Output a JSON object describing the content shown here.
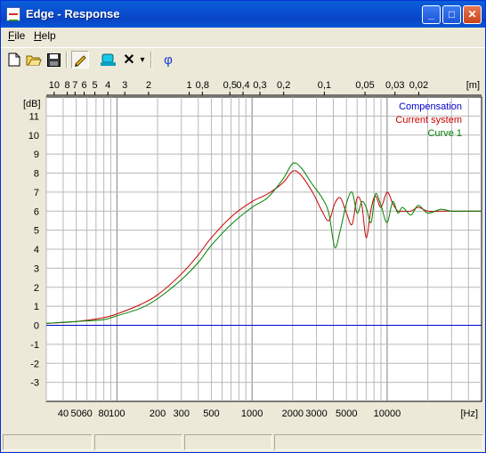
{
  "window": {
    "title": "Edge - Response",
    "minimize_glyph": "_",
    "maximize_glyph": "□",
    "close_glyph": "✕"
  },
  "menu": [
    "File",
    "Help"
  ],
  "toolbar": {
    "icons": [
      "new-file-icon",
      "open-folder-icon",
      "save-disk-icon",
      "pencil-icon",
      "cursor-icon",
      "delete-x-icon",
      "dropdown-arrow-icon",
      "phase-icon"
    ],
    "phase_label": "φ",
    "delete_label": "✕",
    "dropdown_label": "▾"
  },
  "chart_data": {
    "type": "line",
    "xscale": "log",
    "xlim": [
      30,
      50000
    ],
    "ylim": [
      -4,
      12
    ],
    "ylabel": "[dB]",
    "xlabel": "[Hz]",
    "top_axis_label": "[m]",
    "x_ticks": [
      "40",
      "50",
      "60",
      "80",
      "100",
      "200",
      "300",
      "500",
      "1000",
      "2000",
      "3000",
      "5000",
      "10000"
    ],
    "y_ticks": [
      "11",
      "10",
      "9",
      "8",
      "7",
      "6",
      "5",
      "4",
      "3",
      "2",
      "1",
      "0",
      "-1",
      "-2",
      "-3"
    ],
    "top_ticks": [
      "10",
      "8",
      "7",
      "6",
      "5",
      "4",
      "3",
      "2",
      "1",
      "0,8",
      "0,5",
      "0,4",
      "0,3",
      "0,2",
      "0,1",
      "0,05",
      "0,03",
      "0,02"
    ],
    "grid": true,
    "legend_position": "top-right",
    "series": [
      {
        "name": "Compensation",
        "color": "#0000cc",
        "x": [
          30,
          50000
        ],
        "y": [
          0,
          0
        ]
      },
      {
        "name": "Current system",
        "color": "#cc0000",
        "x": [
          30,
          50,
          80,
          100,
          150,
          200,
          300,
          400,
          500,
          700,
          1000,
          1300,
          1700,
          2000,
          2300,
          2800,
          3300,
          3700,
          4100,
          4500,
          5000,
          5500,
          6000,
          6500,
          7000,
          7600,
          8200,
          9000,
          10000,
          11000,
          12000,
          13000,
          15000,
          17000,
          20000,
          25000,
          30000,
          40000,
          50000
        ],
        "y": [
          0.1,
          0.2,
          0.4,
          0.6,
          1.1,
          1.6,
          2.7,
          3.7,
          4.6,
          5.7,
          6.5,
          6.9,
          7.5,
          8.1,
          7.9,
          7.0,
          6.0,
          5.5,
          6.4,
          6.7,
          5.9,
          5.3,
          6.7,
          6.3,
          4.6,
          6.1,
          6.8,
          6.2,
          7.0,
          6.4,
          6.0,
          6.0,
          6.0,
          6.2,
          6.0,
          6.0,
          6.0,
          6.0,
          6.0
        ]
      },
      {
        "name": "Curve 1",
        "color": "#008000",
        "x": [
          30,
          50,
          80,
          100,
          150,
          200,
          300,
          400,
          500,
          700,
          1000,
          1300,
          1700,
          2000,
          2300,
          2800,
          3300,
          3700,
          4100,
          4500,
          5000,
          5500,
          6000,
          6500,
          7000,
          7600,
          8200,
          9000,
          10000,
          11000,
          12000,
          13000,
          15000,
          17000,
          20000,
          25000,
          30000,
          40000,
          50000
        ],
        "y": [
          0.1,
          0.2,
          0.3,
          0.5,
          0.9,
          1.4,
          2.4,
          3.3,
          4.2,
          5.3,
          6.2,
          6.7,
          7.7,
          8.5,
          8.3,
          7.4,
          6.7,
          5.9,
          4.1,
          5.0,
          6.4,
          7.0,
          5.9,
          6.5,
          6.2,
          5.4,
          6.9,
          6.3,
          5.4,
          6.5,
          5.9,
          6.2,
          5.8,
          6.3,
          5.9,
          6.1,
          6.0,
          6.0,
          6.0
        ]
      }
    ]
  },
  "statusbar": {
    "panels": [
      "",
      "",
      "",
      ""
    ]
  }
}
